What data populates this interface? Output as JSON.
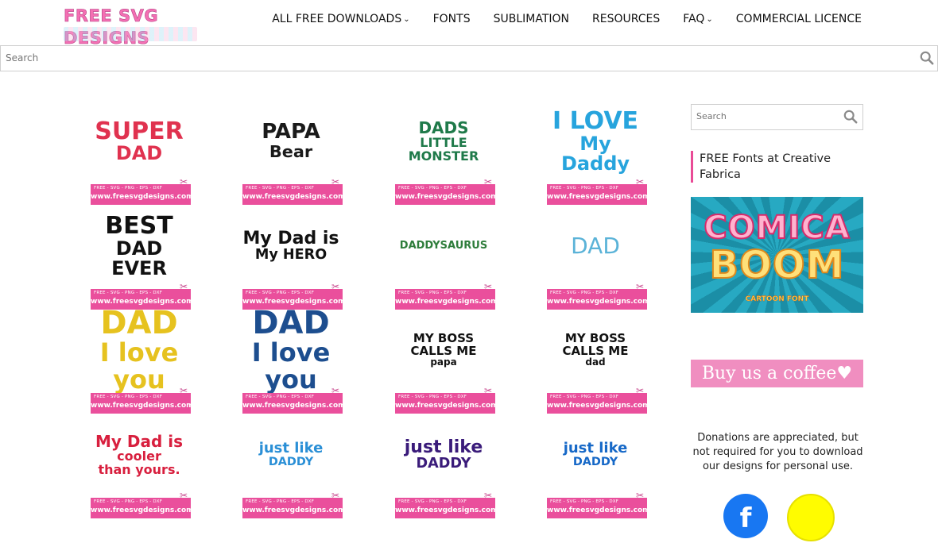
{
  "header": {
    "logo_text": "FREE SVG DESIGNS",
    "nav": [
      {
        "label": "ALL FREE DOWNLOADS",
        "dropdown": true
      },
      {
        "label": "FONTS",
        "dropdown": false
      },
      {
        "label": "SUBLIMATION",
        "dropdown": false
      },
      {
        "label": "RESOURCES",
        "dropdown": false
      },
      {
        "label": "FAQ",
        "dropdown": true
      },
      {
        "label": "COMMERCIAL LICENCE",
        "dropdown": false
      }
    ]
  },
  "search": {
    "placeholder": "Search"
  },
  "tile_band": {
    "formats": "FREE - SVG - PNG - EPS - DXF",
    "url": "www.freesvgdesigns.com"
  },
  "designs": [
    {
      "lines": [
        "SUPER",
        "DAD"
      ]
    },
    {
      "lines": [
        "PAPA",
        "Bear"
      ]
    },
    {
      "lines": [
        "DADS",
        "LITTLE",
        "MONSTER"
      ]
    },
    {
      "lines": [
        "I LOVE",
        "My Daddy"
      ]
    },
    {
      "lines": [
        "BEST",
        "DAD",
        "EVER"
      ]
    },
    {
      "lines": [
        "My Dad is",
        "My HERO"
      ]
    },
    {
      "lines": [
        "DADDYSAURUS"
      ]
    },
    {
      "lines": [
        "DAD"
      ]
    },
    {
      "lines": [
        "DAD",
        "I love you"
      ]
    },
    {
      "lines": [
        "DAD",
        "I love you"
      ]
    },
    {
      "lines": [
        "MY BOSS CALLS ME",
        "papa"
      ]
    },
    {
      "lines": [
        "MY BOSS CALLS ME",
        "dad"
      ]
    },
    {
      "lines": [
        "My Dad is",
        "cooler",
        "than yours."
      ]
    },
    {
      "lines": [
        "just like",
        "DADDY"
      ]
    },
    {
      "lines": [
        "just like",
        "DADDY"
      ]
    },
    {
      "lines": [
        "just like",
        "DADDY"
      ]
    }
  ],
  "sidebar": {
    "search_placeholder": "Search",
    "fonts_title": "FREE Fonts at Creative Fabrica",
    "promo": {
      "line1": "COMICA",
      "line2": "BOOM",
      "line3": "CARTOON FONT"
    },
    "coffee_label": "Buy us a coffee",
    "donation_text": "Donations are appreciated, but not required for you to download our designs for personal use."
  },
  "colors": {
    "brand_pink": "#ea4f9c",
    "nav_text": "#111111",
    "promo_bg": "#1f9bb3"
  }
}
